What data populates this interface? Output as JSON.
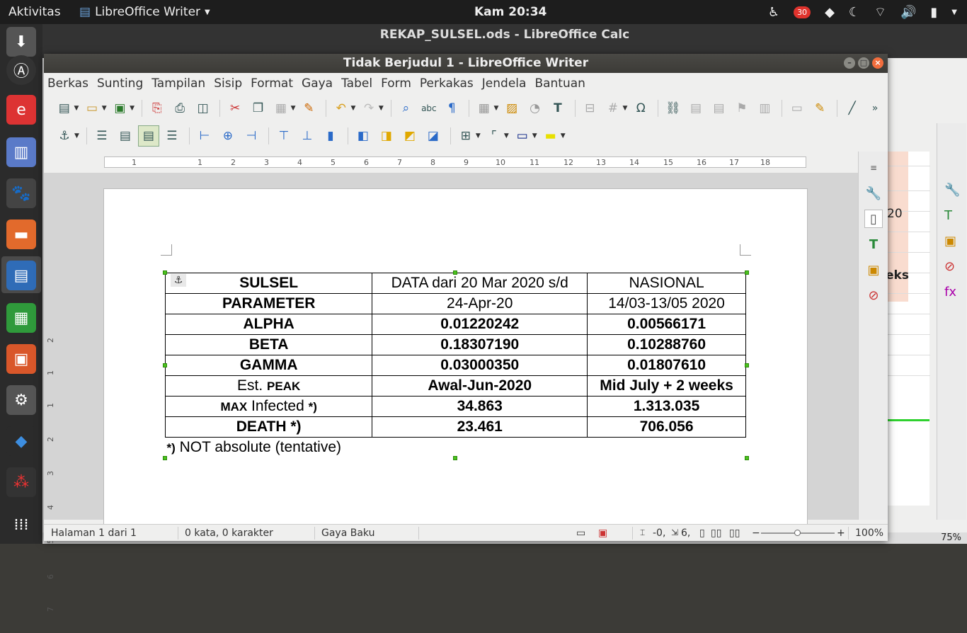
{
  "topbar": {
    "activities": "Aktivitas",
    "app_menu": "LibreOffice Writer",
    "clock": "Kam 20:34",
    "notification_count": "30"
  },
  "calc": {
    "title": "REKAP_SULSEL.ods - LibreOffice Calc",
    "cell_visible_1": "20",
    "cell_visible_2": "eks",
    "zoom": "75%"
  },
  "writer": {
    "title": "Tidak Berjudul 1 - LibreOffice Writer",
    "menu": [
      "Berkas",
      "Sunting",
      "Tampilan",
      "Sisip",
      "Format",
      "Gaya",
      "Tabel",
      "Form",
      "Perkakas",
      "Jendela",
      "Bantuan"
    ],
    "ruler_numbers": [
      "1",
      "1",
      "2",
      "3",
      "4",
      "5",
      "6",
      "7",
      "8",
      "9",
      "10",
      "11",
      "12",
      "13",
      "14",
      "15",
      "16",
      "17",
      "18"
    ],
    "vruler_numbers": [
      "2",
      "1",
      "1",
      "2",
      "3",
      "4",
      "5",
      "6",
      "7"
    ],
    "status": {
      "page": "Halaman 1 dari 1",
      "words": "0 kata, 0 karakter",
      "style": "Gaya Baku",
      "position": "-0,",
      "size": "6,",
      "zoom": "100%"
    }
  },
  "table": {
    "rows": [
      {
        "c1": "SULSEL",
        "c2": "DATA dari 20 Mar 2020 s/d",
        "c3": "NASIONAL"
      },
      {
        "c1": "PARAMETER",
        "c2": "24-Apr-20",
        "c3": "14/03-13/05 2020"
      },
      {
        "c1": "ALPHA",
        "c2": "0.01220242",
        "c3": "0.00566171"
      },
      {
        "c1": "BETA",
        "c2": "0.18307190",
        "c3": "0.10288760"
      },
      {
        "c1": "GAMMA",
        "c2": "0.03000350",
        "c3": "0.01807610"
      },
      {
        "c1_pre": "Est. ",
        "c1_sc": "PEAK",
        "c2": "Awal-Jun-2020",
        "c3": "Mid July + 2 weeks"
      },
      {
        "c1_sc": "MAX",
        "c1_mid": " Infected ",
        "c1_post": "*)",
        "c2": "34.863",
        "c3": "1.313.035"
      },
      {
        "c1": "DEATH *)",
        "c2": "23.461",
        "c3": "706.056"
      }
    ],
    "note_mark": "*)",
    "note_text": " NOT absolute (tentative)"
  }
}
